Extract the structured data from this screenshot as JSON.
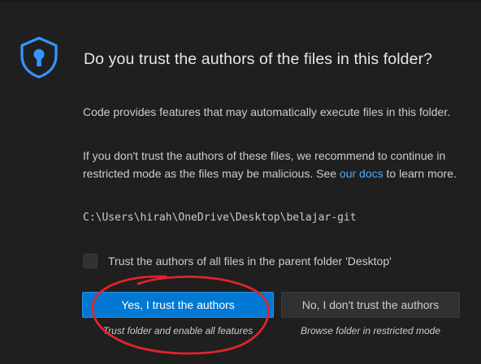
{
  "dialog": {
    "title": "Do you trust the authors of the files in this folder?",
    "paragraph1": "Code provides features that may automatically execute files in this folder.",
    "paragraph2_before_link": "If you don't trust the authors of these files, we recommend to continue in restricted mode as the files may be malicious. See ",
    "paragraph2_link": "our docs",
    "paragraph2_after_link": " to learn more.",
    "folder_path": "C:\\Users\\hirah\\OneDrive\\Desktop\\belajar-git",
    "checkbox_label": "Trust the authors of all files in the parent folder 'Desktop'",
    "checkbox_checked": false,
    "primary_button": {
      "label": "Yes, I trust the authors",
      "caption": "Trust folder and enable all features"
    },
    "secondary_button": {
      "label": "No, I don't trust the authors",
      "caption": "Browse folder in restricted mode"
    }
  },
  "icons": {
    "shield": "shield-lock-icon"
  },
  "colors": {
    "background": "#1f1f1f",
    "primary_button": "#0078d4",
    "secondary_button": "#313131",
    "link": "#4daafc",
    "shield": "#3794ff",
    "annotation": "#e0242b"
  }
}
